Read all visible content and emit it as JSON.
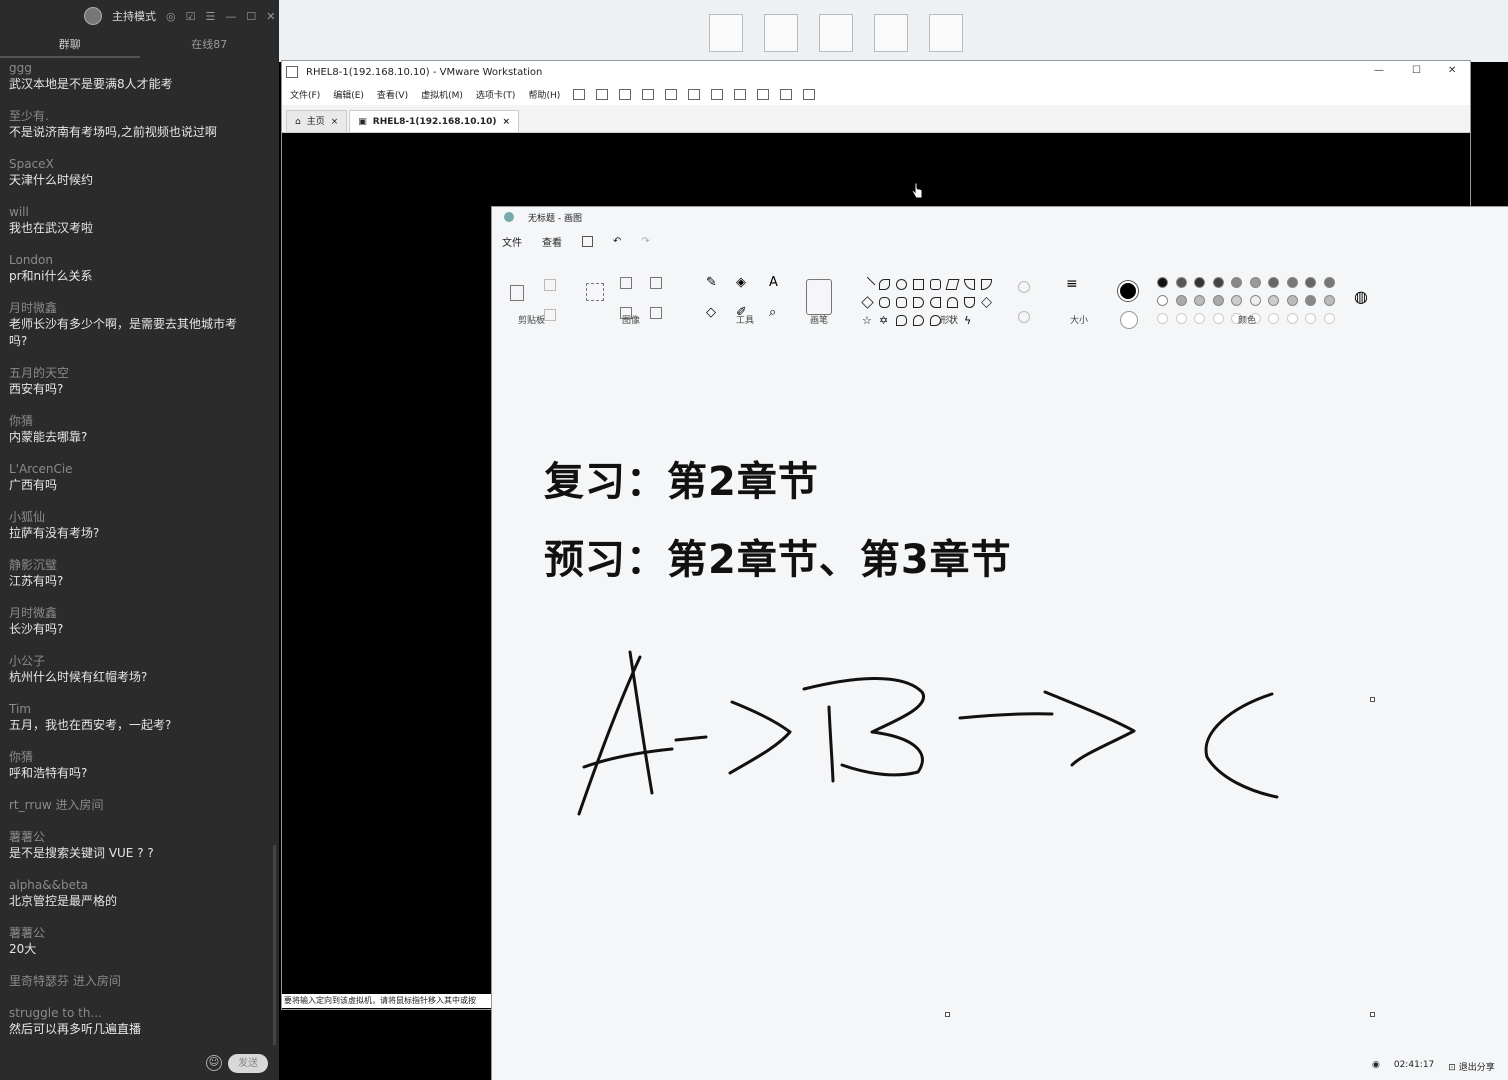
{
  "chat": {
    "mode": "主持模式",
    "tabs": [
      "群聊",
      "在线87"
    ],
    "messages": [
      {
        "user": "ggg",
        "text": "武汉本地是不是要满8人才能考"
      },
      {
        "user": "至少有.",
        "text": "不是说济南有考场吗,之前视频也说过啊"
      },
      {
        "user": "SpaceX",
        "text": "天津什么时候约"
      },
      {
        "user": "will",
        "text": "我也在武汉考啦"
      },
      {
        "user": "London",
        "text": "pr和ni什么关系"
      },
      {
        "user": "月时微鑫",
        "text": "老师长沙有多少个啊，是需要去其他城市考吗?"
      },
      {
        "user": "五月的天空",
        "text": "西安有吗?"
      },
      {
        "user": "你猜",
        "text": "内蒙能去哪靠?"
      },
      {
        "user": "L'ArcenCie",
        "text": "广西有吗"
      },
      {
        "user": "小狐仙",
        "text": "拉萨有没有考场?"
      },
      {
        "user": "静影沉璧",
        "text": "江苏有吗?"
      },
      {
        "user": "月时微鑫",
        "text": "长沙有吗?"
      },
      {
        "user": "小公子",
        "text": "杭州什么时候有红帽考场?"
      },
      {
        "user": "Tim",
        "text": "五月，我也在西安考，一起考?"
      },
      {
        "user": "你猜",
        "text": "呼和浩特有吗?"
      },
      {
        "system": "rt_rruw 进入房间"
      },
      {
        "user": "薯薯公",
        "text": "是不是搜索关键词 VUE ? ?"
      },
      {
        "user": "alpha&&beta",
        "text": "北京管控是最严格的"
      },
      {
        "user": "薯薯公",
        "text": "20大"
      },
      {
        "system": "里奇特瑟芬 进入房间"
      },
      {
        "user": "struggle to th...",
        "text": "然后可以再多听几遍直播"
      }
    ],
    "send_label": "发送"
  },
  "vmware": {
    "title": "RHEL8-1(192.168.10.10) - VMware Workstation",
    "menu": [
      "文件(F)",
      "编辑(E)",
      "查看(V)",
      "虚拟机(M)",
      "选项卡(T)",
      "帮助(H)"
    ],
    "tabs": [
      {
        "label": "主页",
        "active": false
      },
      {
        "label": "RHEL8-1(192.168.10.10)",
        "active": true
      }
    ],
    "status": "要将输入定向到该虚拟机，请将鼠标指针移入其中或按"
  },
  "paint": {
    "title": "无标题 - 画图",
    "menu": [
      "文件",
      "查看"
    ],
    "groups": [
      "剪贴板",
      "图像",
      "工具",
      "画笔",
      "形状",
      "大小",
      "颜色"
    ],
    "line1": "复习：第2章节",
    "line2": "预习：第2章节、第3章节",
    "status_time": "02:41:17",
    "status_share": "退出分享"
  }
}
